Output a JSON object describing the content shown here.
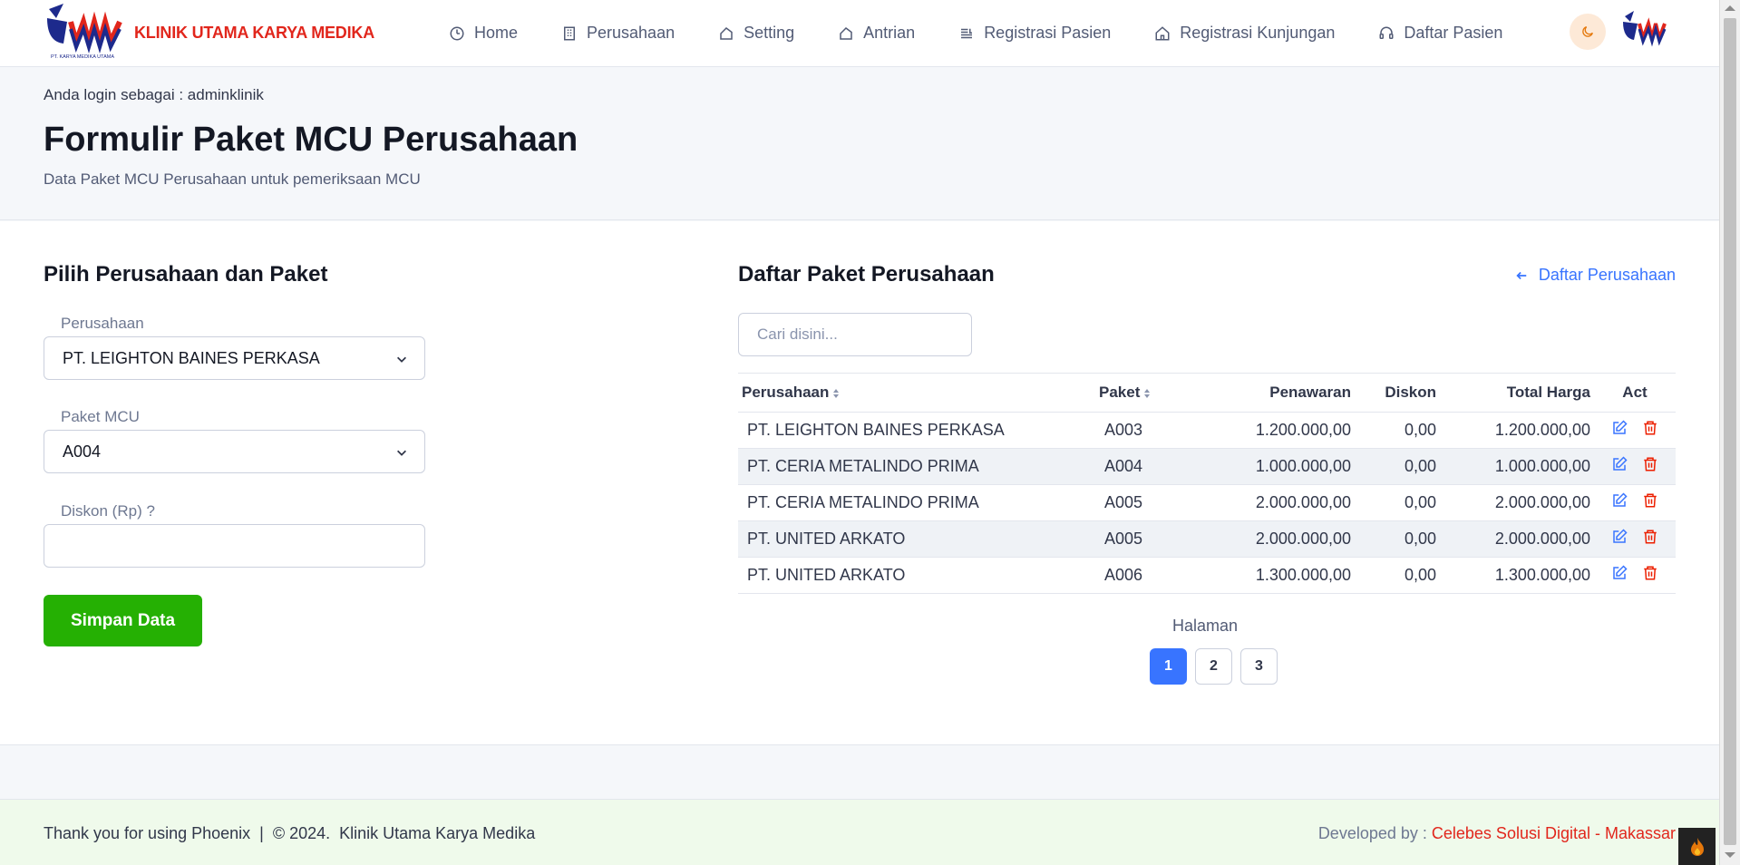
{
  "brand": {
    "name": "KLINIK UTAMA KARYA MEDIKA",
    "logo_caption": "PT. KARYA MEDIKA UTAMA"
  },
  "nav": {
    "items": [
      {
        "label": "Home",
        "icon": "clock-icon"
      },
      {
        "label": "Perusahaan",
        "icon": "building-icon"
      },
      {
        "label": "Setting",
        "icon": "tag-icon"
      },
      {
        "label": "Antrian",
        "icon": "tag-icon"
      },
      {
        "label": "Registrasi Pasien",
        "icon": "list-icon"
      },
      {
        "label": "Registrasi Kunjungan",
        "icon": "home-icon"
      },
      {
        "label": "Daftar Pasien",
        "icon": "headset-icon"
      }
    ]
  },
  "header": {
    "login_text": "Anda login sebagai : adminklinik",
    "title": "Formulir Paket MCU Perusahaan",
    "subtitle": "Data Paket MCU Perusahaan untuk pemeriksaan MCU"
  },
  "form": {
    "title": "Pilih Perusahaan dan Paket",
    "company_label": "Perusahaan",
    "company_value": "PT. LEIGHTON BAINES PERKASA",
    "package_label": "Paket MCU",
    "package_value": "A004",
    "discount_label": "Diskon (Rp) ?",
    "discount_value": "",
    "save_label": "Simpan Data"
  },
  "list": {
    "title": "Daftar Paket Perusahaan",
    "back_link": "Daftar Perusahaan",
    "search_placeholder": "Cari disini...",
    "columns": [
      "Perusahaan",
      "Paket",
      "Penawaran",
      "Diskon",
      "Total Harga",
      "Act"
    ],
    "rows": [
      {
        "company": "PT. LEIGHTON BAINES PERKASA",
        "package": "A003",
        "offer": "1.200.000,00",
        "discount": "0,00",
        "total": "1.200.000,00"
      },
      {
        "company": "PT. CERIA METALINDO PRIMA",
        "package": "A004",
        "offer": "1.000.000,00",
        "discount": "0,00",
        "total": "1.000.000,00"
      },
      {
        "company": "PT. CERIA METALINDO PRIMA",
        "package": "A005",
        "offer": "2.000.000,00",
        "discount": "0,00",
        "total": "2.000.000,00"
      },
      {
        "company": "PT. UNITED ARKATO",
        "package": "A005",
        "offer": "2.000.000,00",
        "discount": "0,00",
        "total": "2.000.000,00"
      },
      {
        "company": "PT. UNITED ARKATO",
        "package": "A006",
        "offer": "1.300.000,00",
        "discount": "0,00",
        "total": "1.300.000,00"
      }
    ],
    "pagination_label": "Halaman",
    "pages": [
      "1",
      "2",
      "3"
    ],
    "active_page": "1"
  },
  "footer": {
    "left": "Thank you for using Phoenix  |  © 2024.  Klinik Utama Karya Medika",
    "dev_prefix": "Developed by : ",
    "dev_name": "Celebes Solusi Digital - Makassar"
  },
  "colors": {
    "brand_red": "#e1261c",
    "primary": "#3874ff",
    "success": "#25b003",
    "danger": "#ec1f00"
  }
}
